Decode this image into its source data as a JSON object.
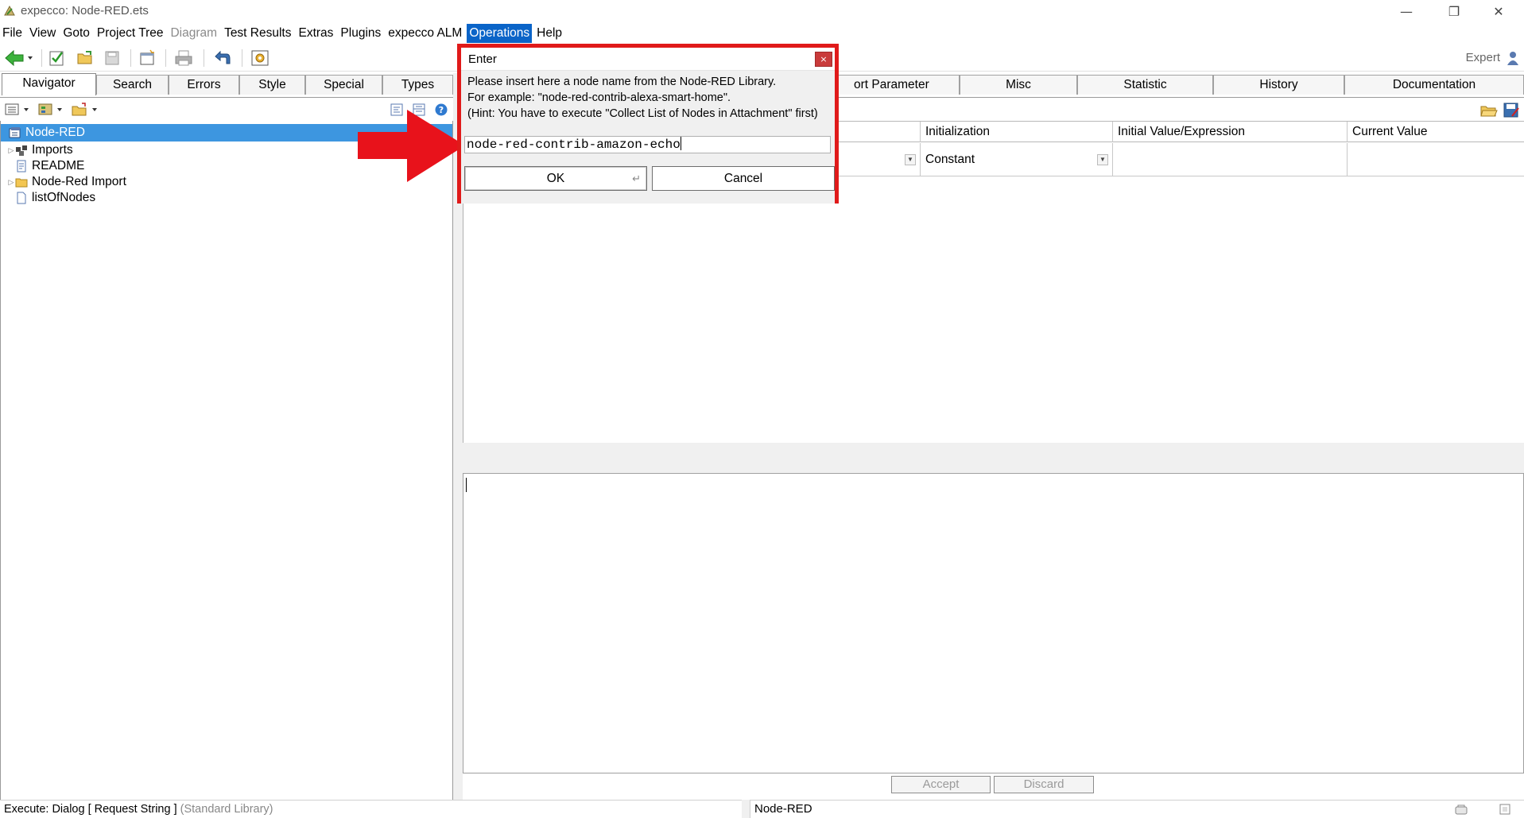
{
  "window": {
    "title": "expecco: Node-RED.ets"
  },
  "menu": [
    "File",
    "View",
    "Goto",
    "Project Tree",
    "Diagram",
    "Test Results",
    "Extras",
    "Plugins",
    "expecco ALM",
    "Operations",
    "Help"
  ],
  "menu_disabled": [
    "Diagram"
  ],
  "menu_active": "Operations",
  "toolbar": {
    "mode_label": "Expert"
  },
  "left_tabs": [
    "Navigator",
    "Search",
    "Errors",
    "Style",
    "Special",
    "Types"
  ],
  "left_tab_active": "Navigator",
  "tree": [
    {
      "label": "Node-RED",
      "icon": "project-icon",
      "selected": true,
      "expandable": false
    },
    {
      "label": "Imports",
      "icon": "imports-icon",
      "selected": false,
      "expandable": true
    },
    {
      "label": "README",
      "icon": "document-icon",
      "selected": false,
      "expandable": false
    },
    {
      "label": "Node-Red Import",
      "icon": "folder-icon",
      "selected": false,
      "expandable": true
    },
    {
      "label": "listOfNodes",
      "icon": "file-icon",
      "selected": false,
      "expandable": false
    }
  ],
  "right_tabs": [
    "ort Parameter",
    "Misc",
    "Statistic",
    "History",
    "Documentation"
  ],
  "grid": {
    "headers": [
      "Initialization",
      "Initial Value/Expression",
      "Current Value"
    ],
    "row": {
      "initialization": "Constant",
      "initial_value": "",
      "current_value": ""
    }
  },
  "editor_buttons": {
    "accept": "Accept",
    "discard": "Discard"
  },
  "status": {
    "left_main": "Execute: Dialog [ Request String ]",
    "left_dim": "(Standard Library)",
    "right": "Node-RED"
  },
  "dialog": {
    "title": "Enter",
    "close": "×",
    "lines": [
      "Please insert here a node name from the Node-RED Library.",
      "For example: \"node-red-contrib-alexa-smart-home\".",
      "(Hint: You have to execute \"Collect List of Nodes in Attachment\" first)"
    ],
    "input_value": "node-red-contrib-amazon-echo",
    "ok_label": "OK",
    "cancel_label": "Cancel"
  },
  "colors": {
    "highlight_frame": "#e01a1a",
    "arrow": "#e8121b",
    "selection": "#3d96e0",
    "menu_active": "#0a64c8"
  }
}
